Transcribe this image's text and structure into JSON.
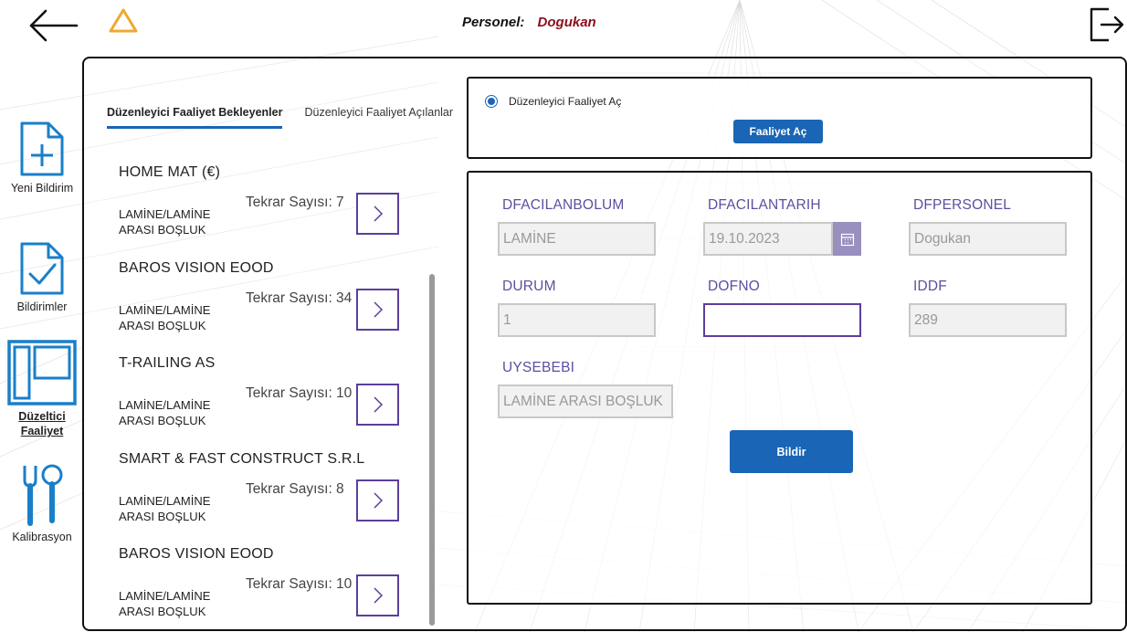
{
  "header": {
    "personel_label": "Personel:",
    "personel_name": "Dogukan"
  },
  "nav": {
    "items": [
      {
        "label": "Yeni Bildirim",
        "icon": "new-document-icon",
        "active": false
      },
      {
        "label": "Bildirimler",
        "icon": "checked-document-icon",
        "active": false
      },
      {
        "label": "Düzeltici Faaliyet",
        "label_line1": "Düzeltici",
        "label_line2": "Faaliyet",
        "icon": "layout-panels-icon",
        "active": true
      },
      {
        "label": "Kalibrasyon",
        "icon": "tools-icon",
        "active": false
      }
    ]
  },
  "tabs": [
    {
      "label": "Düzenleyici Faaliyet Bekleyenler",
      "active": true
    },
    {
      "label": "Düzenleyici Faaliyet Açılanlar",
      "active": false
    }
  ],
  "list": {
    "items": [
      {
        "company": "HOME MAT (€)",
        "type": "LAMİNE/LAMİNE ARASI BOŞLUK",
        "count": "Tekrar Sayısı: 7"
      },
      {
        "company": "BAROS VISION EOOD",
        "type": "LAMİNE/LAMİNE ARASI BOŞLUK",
        "count": "Tekrar Sayısı: 34"
      },
      {
        "company": "T-RAILING AS",
        "type": "LAMİNE/LAMİNE ARASI BOŞLUK",
        "count": "Tekrar Sayısı: 10"
      },
      {
        "company": "SMART & FAST CONSTRUCT S.R.L",
        "type": "LAMİNE/LAMİNE ARASI BOŞLUK",
        "count": "Tekrar Sayısı: 8"
      },
      {
        "company": "BAROS VISION EOOD",
        "type": "LAMİNE/LAMİNE ARASI BOŞLUK",
        "count": "Tekrar Sayısı: 10"
      }
    ]
  },
  "action": {
    "radio_label": "Düzenleyici Faaliyet Aç",
    "radio_selected": true,
    "open_button": "Faaliyet Aç"
  },
  "form": {
    "fields": {
      "dfacilanbolum": {
        "label": "DFACILANBOLUM",
        "value": "LAMİNE"
      },
      "dfacilantarih": {
        "label": "DFACILANTARIH",
        "value": "19.10.2023"
      },
      "dfpersonel": {
        "label": "DFPERSONEL",
        "value": "Dogukan"
      },
      "durum": {
        "label": "DURUM",
        "value": "1"
      },
      "dofno": {
        "label": "DOFNO",
        "value": ""
      },
      "iddf": {
        "label": "IDDF",
        "value": "289"
      },
      "uysebebi": {
        "label": "UYSEBEBI",
        "value": "LAMİNE ARASI BOŞLUK"
      }
    },
    "submit_button": "Bildir"
  },
  "colors": {
    "accent_blue": "#1a65b5",
    "field_label_purple": "#5b4fa0",
    "border_purple": "#5b3f9c",
    "personel_name_red": "#8b0d1a"
  }
}
